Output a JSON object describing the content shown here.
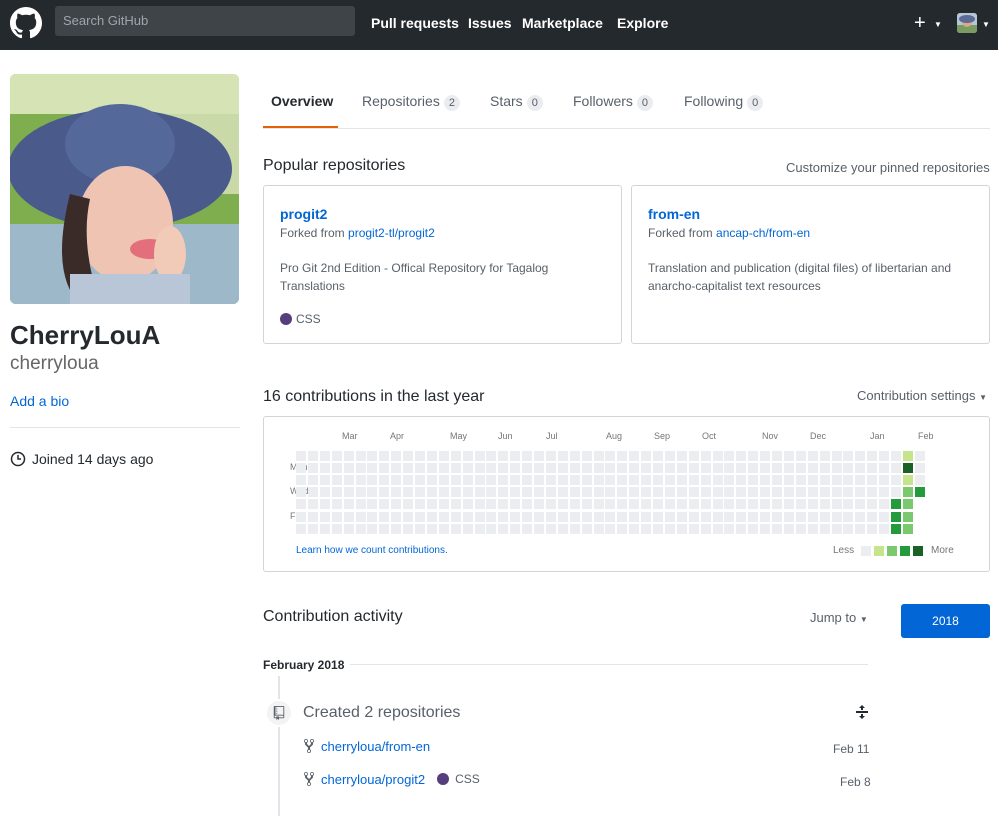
{
  "header": {
    "search_placeholder": "Search GitHub",
    "nav": [
      "Pull requests",
      "Issues",
      "Marketplace",
      "Explore"
    ],
    "plus": "+"
  },
  "profile": {
    "fullname": "CherryLouA",
    "username": "cherryloua",
    "add_bio": "Add a bio",
    "joined": "Joined 14 days ago"
  },
  "tabs": [
    {
      "label": "Overview",
      "count": null
    },
    {
      "label": "Repositories",
      "count": "2"
    },
    {
      "label": "Stars",
      "count": "0"
    },
    {
      "label": "Followers",
      "count": "0"
    },
    {
      "label": "Following",
      "count": "0"
    }
  ],
  "popular": {
    "title": "Popular repositories",
    "customize": "Customize your pinned repositories",
    "repos": [
      {
        "name": "progit2",
        "fork_prefix": "Forked from",
        "fork_source": "progit2-tl/progit2",
        "description": "Pro Git 2nd Edition - Offical Repository for Tagalog Translations",
        "language": "CSS"
      },
      {
        "name": "from-en",
        "fork_prefix": "Forked from",
        "fork_source": "ancap-ch/from-en",
        "description": "Translation and publication (digital files) of libertarian and anarcho-capitalist text resources",
        "language": ""
      }
    ]
  },
  "contributions": {
    "title": "16 contributions in the last year",
    "settings": "Contribution settings",
    "months": [
      "Mar",
      "Apr",
      "May",
      "Jun",
      "Jul",
      "Aug",
      "Sep",
      "Oct",
      "Nov",
      "Dec",
      "Jan",
      "Feb"
    ],
    "days": [
      "Mon",
      "Wed",
      "Fri"
    ],
    "learn": "Learn how we count contributions.",
    "less": "Less",
    "more": "More",
    "colors": [
      "#ebedf0",
      "#c6e48b",
      "#7bc96f",
      "#239a3b",
      "#196127"
    ]
  },
  "activity": {
    "title": "Contribution activity",
    "jump_to": "Jump to",
    "year": "2018",
    "month": "February 2018",
    "created_title": "Created 2 repositories",
    "items": [
      {
        "repo": "cherryloua/from-en",
        "language": "",
        "date": "Feb 11"
      },
      {
        "repo": "cherryloua/progit2",
        "language": "CSS",
        "date": "Feb 8"
      }
    ]
  }
}
